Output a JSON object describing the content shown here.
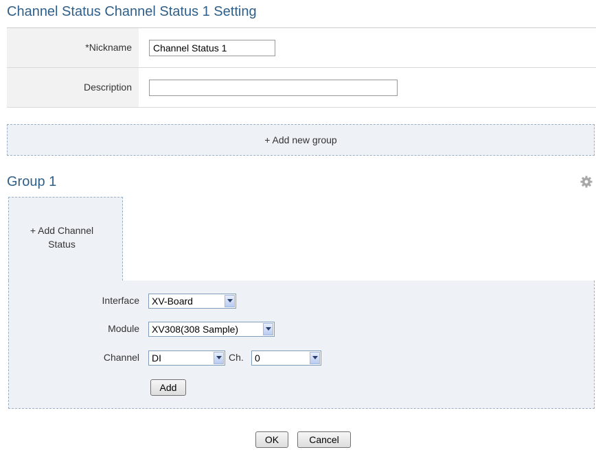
{
  "page": {
    "title": "Channel Status Channel Status 1 Setting"
  },
  "form": {
    "nickname_label": "*Nickname",
    "nickname_value": "Channel Status 1",
    "description_label": "Description",
    "description_value": ""
  },
  "add_group_label": "+ Add new group",
  "group": {
    "title": "Group 1",
    "add_channel_line1": "+ Add Channel",
    "add_channel_line2": "Status",
    "interface_label": "Interface",
    "interface_value": "XV-Board",
    "module_label": "Module",
    "module_value": "XV308(308 Sample)",
    "channel_label": "Channel",
    "channel_value": "DI",
    "ch_label": "Ch.",
    "ch_value": "0",
    "add_button": "Add"
  },
  "footer": {
    "ok_label": "OK",
    "cancel_label": "Cancel"
  },
  "colors": {
    "title": "#2e5f8a",
    "panel_bg": "#eef2f6",
    "dashed_border": "#9aaec4",
    "label_bg": "#f2f2f2"
  },
  "icons": {
    "settings": "gear-icon",
    "dropdown": "chevron-down-icon"
  }
}
